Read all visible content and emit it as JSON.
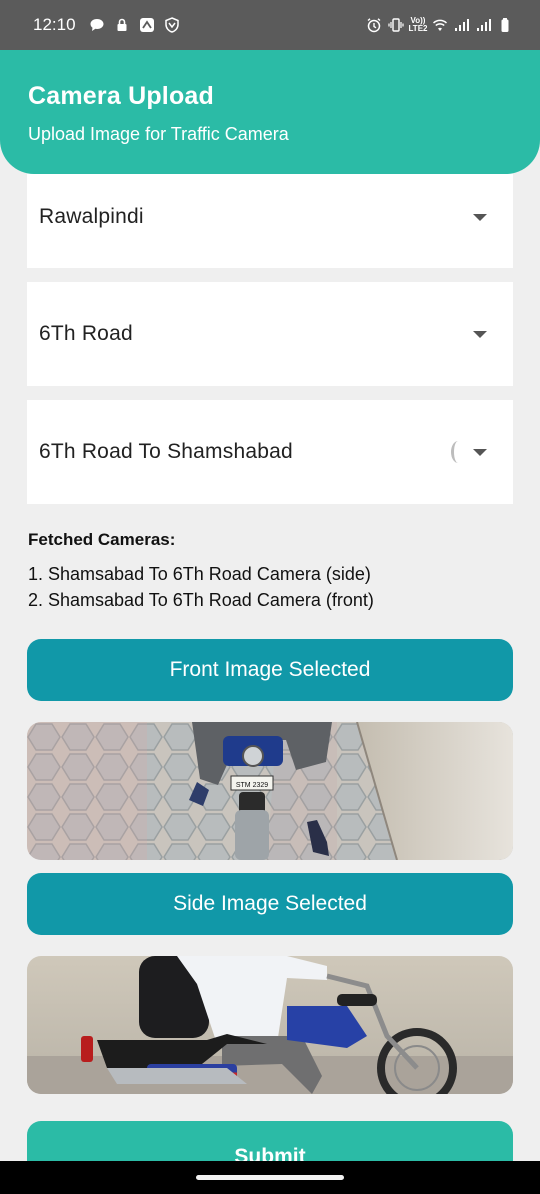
{
  "status_bar": {
    "time": "12:10",
    "left_icons": [
      "chat-bubble-icon",
      "lock-icon",
      "app-icon",
      "shield-icon"
    ],
    "right_icons": [
      "alarm-icon",
      "vibrate-icon",
      "volte-icon",
      "wifi-icon",
      "signal-icon",
      "signal-icon",
      "battery-icon"
    ],
    "volte_text_top": "Vo))",
    "volte_text_bottom": "LTE2"
  },
  "header": {
    "title": "Camera Upload",
    "subtitle": "Upload Image for Traffic Camera",
    "color": "#2bbba6"
  },
  "dropdowns": [
    {
      "value": "Rawalpindi"
    },
    {
      "value": "6Th Road"
    },
    {
      "value": "6Th Road To Shamshabad",
      "loading": true
    }
  ],
  "fetched_cameras": {
    "title": "Fetched Cameras:",
    "items": [
      "1. Shamsabad To 6Th Road Camera (side)",
      "2. Shamsabad To 6Th Road Camera (front)"
    ]
  },
  "front_button": {
    "label": "Front Image Selected",
    "color": "#1198a8"
  },
  "front_image": {
    "plate_text": "STM 2329"
  },
  "side_button": {
    "label": "Side Image Selected",
    "color": "#1198a8"
  },
  "submit_button": {
    "label": "Submit",
    "color": "#2bbba6"
  }
}
